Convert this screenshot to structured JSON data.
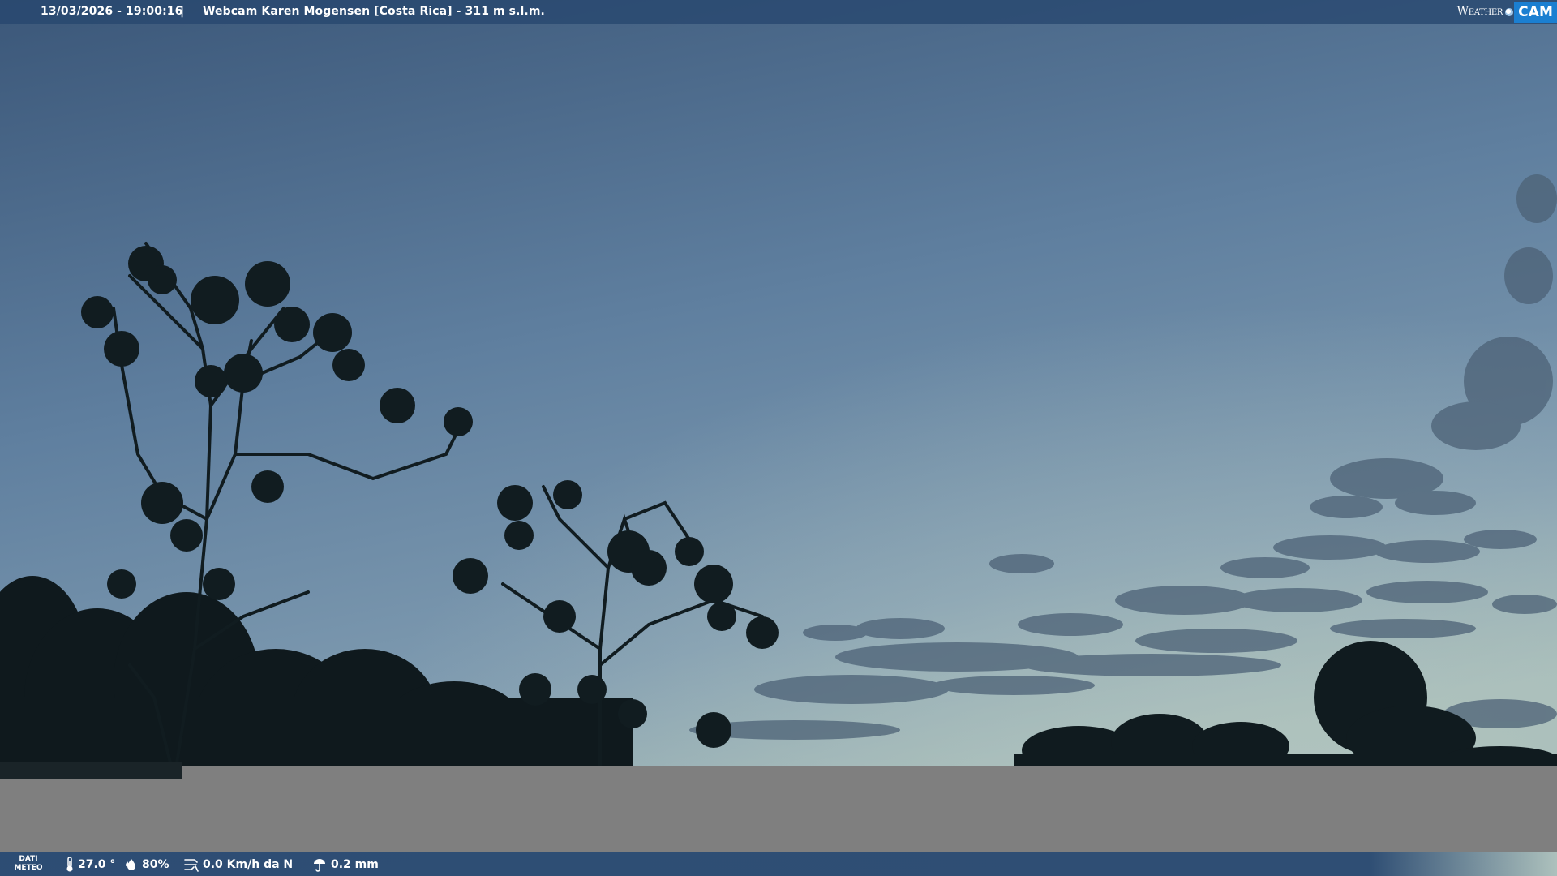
{
  "header": {
    "datetime": "13/03/2026 - 19:00:16",
    "separator": "|",
    "title": "Webcam Karen Mogensen [Costa Rica]  - 311 m s.l.m."
  },
  "brand": {
    "weather": "Weather",
    "cam": "CAM",
    "accent_color": "#1b7fd1"
  },
  "meteo": {
    "label_line1": "DATI",
    "label_line2": "METEO",
    "temperature": "27.0 °",
    "humidity": "80%",
    "wind": "0.0 Km/h da N",
    "rain": "0.2 mm",
    "icons": [
      "thermometer-icon",
      "humidity-icon",
      "wind-icon",
      "rain-icon"
    ]
  },
  "colors": {
    "sky_top": "#3f5c80",
    "sky_mid": "#6b89a5",
    "sky_horizon": "#9fb8b8",
    "silhouette": "#0f1a1e",
    "panel_gray": "#7f7f7f",
    "bar_blue": "#26466e"
  }
}
